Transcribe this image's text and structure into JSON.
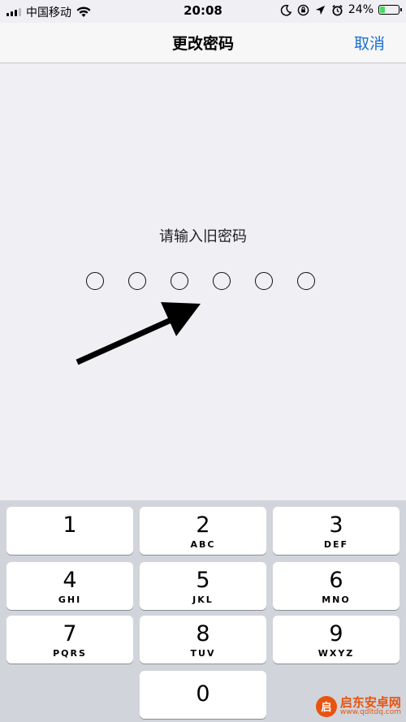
{
  "status_bar": {
    "carrier": "中国移动",
    "time": "20:08",
    "battery_percent": "24%",
    "battery_color": "#4cd964",
    "icons": [
      "signal-icon",
      "wifi-icon",
      "moon-icon",
      "rotation-lock-icon",
      "location-icon",
      "alarm-icon",
      "battery-icon"
    ]
  },
  "nav": {
    "title": "更改密码",
    "cancel_label": "取消",
    "accent_color": "#1a6fd1"
  },
  "prompt": {
    "text": "请输入旧密码",
    "passcode_length": 6
  },
  "keypad": {
    "keys": [
      {
        "num": "1",
        "letters": ""
      },
      {
        "num": "2",
        "letters": "ABC"
      },
      {
        "num": "3",
        "letters": "DEF"
      },
      {
        "num": "4",
        "letters": "GHI"
      },
      {
        "num": "5",
        "letters": "JKL"
      },
      {
        "num": "6",
        "letters": "MNO"
      },
      {
        "num": "7",
        "letters": "PQRS"
      },
      {
        "num": "8",
        "letters": "TUV"
      },
      {
        "num": "9",
        "letters": "WXYZ"
      },
      {
        "num": "0",
        "letters": ""
      }
    ]
  },
  "watermark": {
    "name": "启东安卓网",
    "url": "www.qdltdq.com"
  }
}
